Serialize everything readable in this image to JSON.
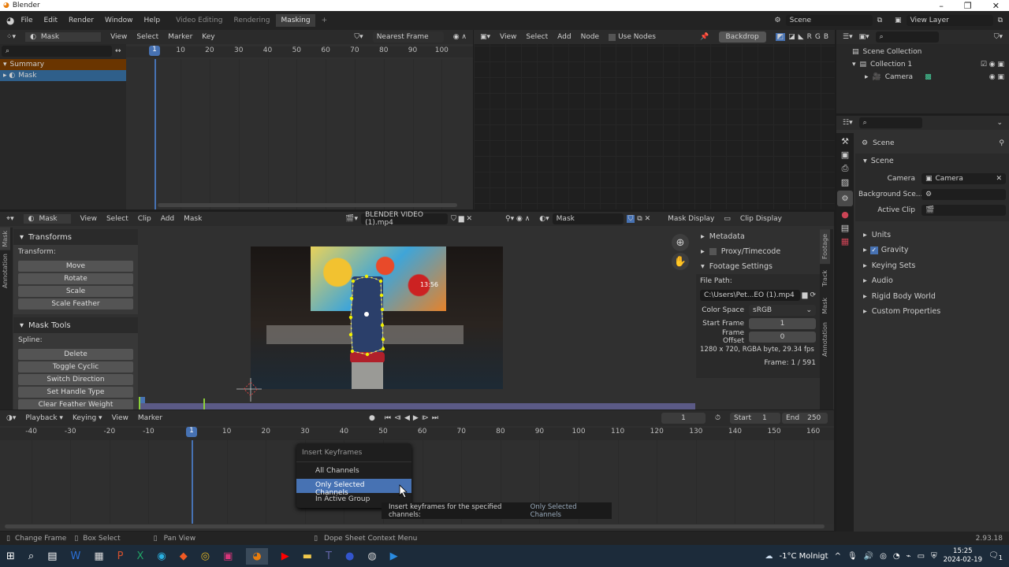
{
  "window": {
    "title": "Blender"
  },
  "topbar": {
    "menu": [
      "File",
      "Edit",
      "Render",
      "Window",
      "Help"
    ],
    "workspaces": [
      "Video Editing",
      "Rendering",
      "Masking"
    ],
    "active_workspace": "Masking",
    "add": "+",
    "scene": "Scene",
    "view_layer": "View Layer"
  },
  "dopesheet": {
    "mode": "Mask",
    "menu": [
      "View",
      "Select",
      "Marker",
      "Key"
    ],
    "snap": "Nearest Frame",
    "current_frame": "1",
    "ticks": [
      10,
      20,
      30,
      40,
      50,
      60,
      70,
      80,
      90,
      100
    ],
    "channels": [
      {
        "label": "Summary"
      },
      {
        "label": "Mask"
      }
    ]
  },
  "node_editor": {
    "menu": [
      "View",
      "Select",
      "Add",
      "Node"
    ],
    "use_nodes": "Use Nodes",
    "backdrop": "Backdrop",
    "channels": [
      "R",
      "G",
      "B"
    ]
  },
  "outliner": {
    "items": [
      {
        "label": "Scene Collection"
      },
      {
        "label": "Collection 1"
      },
      {
        "label": "Camera"
      }
    ]
  },
  "properties": {
    "breadcrumb": "Scene",
    "section": "Scene",
    "fields": [
      {
        "label": "Camera",
        "value": "Camera"
      },
      {
        "label": "Background Sce...",
        "value": ""
      },
      {
        "label": "Active Clip",
        "value": ""
      }
    ],
    "panels": [
      {
        "label": "Units"
      },
      {
        "label": "Gravity",
        "checked": true
      },
      {
        "label": "Keying Sets"
      },
      {
        "label": "Audio"
      },
      {
        "label": "Rigid Body World"
      },
      {
        "label": "Custom Properties"
      }
    ]
  },
  "clip_editor": {
    "mode": "Mask",
    "menu": [
      "View",
      "Select",
      "Clip",
      "Add",
      "Mask"
    ],
    "clip_name": "BLENDER VIDEO (1).mp4",
    "mask_name": "Mask",
    "mask_display": "Mask Display",
    "clip_display": "Clip Display",
    "toolbar_tabs": [
      "Mask",
      "Annotation"
    ],
    "transforms": {
      "title": "Transforms",
      "label": "Transform:",
      "buttons": [
        "Move",
        "Rotate",
        "Scale",
        "Scale Feather"
      ]
    },
    "mask_tools": {
      "title": "Mask Tools",
      "label": "Spline:",
      "buttons": [
        "Delete",
        "Toggle Cyclic",
        "Switch Direction",
        "Set Handle Type",
        "Clear Feather Weight"
      ]
    },
    "video_overlay_time": "13:56",
    "sidebar": {
      "tabs": [
        "Footage",
        "Track",
        "Mask",
        "Annotation"
      ],
      "metadata": "Metadata",
      "proxy": "Proxy/Timecode",
      "footage_settings": "Footage Settings",
      "file_path_label": "File Path:",
      "file_path": "C:\\Users\\Pet...EO (1).mp4",
      "color_space_label": "Color Space",
      "color_space": "sRGB",
      "start_frame_label": "Start Frame",
      "start_frame": "1",
      "frame_offset_label": "Frame Offset",
      "frame_offset": "0",
      "info": "1280 x 720, RGBA byte, 29.34 fps",
      "frame_info": "Frame: 1 / 591"
    }
  },
  "timeline": {
    "menu": [
      "Playback",
      "Keying",
      "View",
      "Marker"
    ],
    "current_frame": "1",
    "start_label": "Start",
    "start": "1",
    "end_label": "End",
    "end": "250",
    "ticks": [
      -40,
      -30,
      -20,
      -10,
      10,
      20,
      30,
      40,
      50,
      60,
      70,
      80,
      90,
      100,
      110,
      120,
      130,
      140,
      150,
      160
    ],
    "playhead": "1"
  },
  "context_menu": {
    "title": "Insert Keyframes",
    "items": [
      "All Channels",
      "Only Selected Channels",
      "In Active Group"
    ],
    "highlighted": 1,
    "tooltip": "Insert keyframes for the specified channels:",
    "tooltip_value": "Only Selected Channels"
  },
  "statusbar": {
    "items": [
      "Change Frame",
      "Box Select",
      "Pan View",
      "Dope Sheet Context Menu"
    ],
    "version": "2.93.18"
  },
  "taskbar": {
    "weather": "-1°C  Molnigt",
    "time": "15:25",
    "date": "2024-02-19",
    "notifications": "1",
    "apps": [
      "windows",
      "search",
      "task-view",
      "word",
      "store",
      "powerpoint",
      "excel",
      "edge",
      "brave",
      "chrome",
      "instagram",
      "blender",
      "youtube",
      "file-explorer",
      "teams",
      "app-blue",
      "app-obs",
      "app-media"
    ]
  },
  "colors": {
    "accent": "#4772b3",
    "summary": "#6a3500",
    "mask_spline": "#f0f000"
  }
}
